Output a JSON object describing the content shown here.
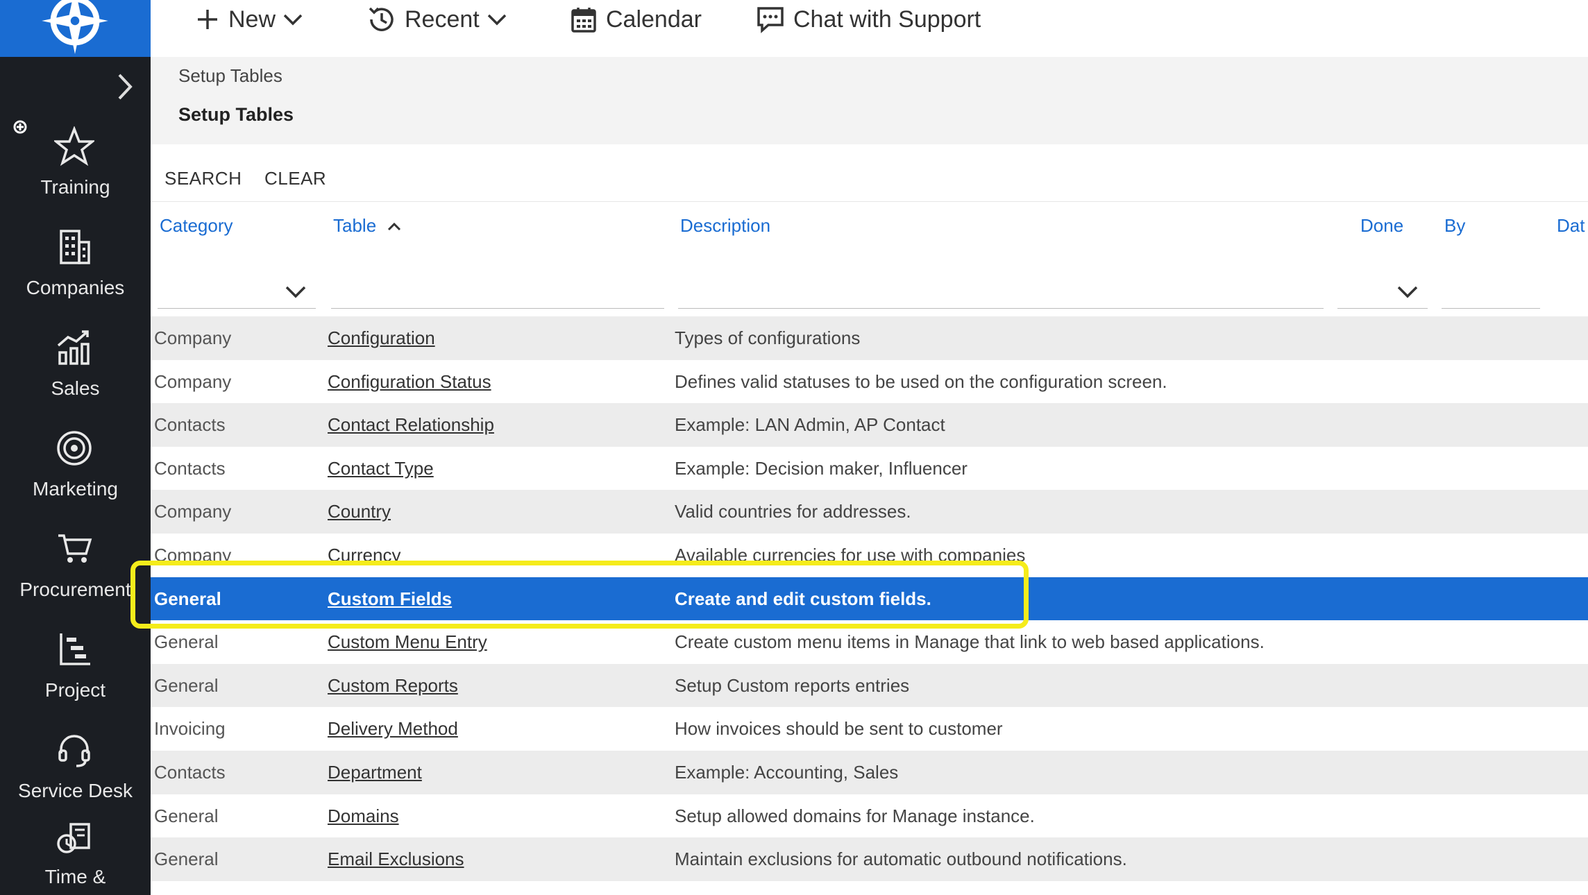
{
  "colors": {
    "sidebar": "#1b1e23",
    "accent": "#1a6cd2",
    "highlight": "#f5ec1b"
  },
  "topbar": {
    "new_label": "New",
    "recent_label": "Recent",
    "calendar_label": "Calendar",
    "chat_label": "Chat with Support"
  },
  "sidebar": {
    "items": [
      {
        "label": "Training",
        "icon": "star-icon"
      },
      {
        "label": "Companies",
        "icon": "building-icon"
      },
      {
        "label": "Sales",
        "icon": "sales-chart-icon"
      },
      {
        "label": "Marketing",
        "icon": "target-icon"
      },
      {
        "label": "Procurement",
        "icon": "cart-icon"
      },
      {
        "label": "Project",
        "icon": "project-list-icon"
      },
      {
        "label": "Service Desk",
        "icon": "headset-icon"
      },
      {
        "label": "Time &",
        "icon": "time-expense-icon"
      }
    ]
  },
  "breadcrumb": {
    "parent": "Setup Tables",
    "current": "Setup Tables"
  },
  "actions": {
    "search": "SEARCH",
    "clear": "CLEAR"
  },
  "columns": {
    "category": "Category",
    "table": "Table",
    "description": "Description",
    "done": "Done",
    "by": "By",
    "date": "Dat"
  },
  "rows": [
    {
      "category": "Company",
      "table": "Configuration",
      "description": "Types of configurations"
    },
    {
      "category": "Company",
      "table": "Configuration Status",
      "description": "Defines valid statuses to be used on the configuration screen."
    },
    {
      "category": "Contacts",
      "table": "Contact Relationship",
      "description": "Example: LAN Admin, AP Contact"
    },
    {
      "category": "Contacts",
      "table": "Contact Type",
      "description": "Example: Decision maker, Influencer"
    },
    {
      "category": "Company",
      "table": "Country",
      "description": "Valid countries for addresses."
    },
    {
      "category": "Company",
      "table": "Currency",
      "description": "Available currencies for use with companies"
    },
    {
      "category": "General",
      "table": "Custom Fields",
      "description": "Create and edit custom fields.",
      "selected": true
    },
    {
      "category": "General",
      "table": "Custom Menu Entry",
      "description": "Create custom menu items in Manage that link to web based applications."
    },
    {
      "category": "General",
      "table": "Custom Reports",
      "description": "Setup Custom reports entries"
    },
    {
      "category": "Invoicing",
      "table": "Delivery Method",
      "description": "How invoices should be sent to customer"
    },
    {
      "category": "Contacts",
      "table": "Department",
      "description": "Example: Accounting, Sales"
    },
    {
      "category": "General",
      "table": "Domains",
      "description": "Setup allowed domains for Manage instance."
    },
    {
      "category": "General",
      "table": "Email Exclusions",
      "description": "Maintain exclusions for automatic outbound notifications."
    }
  ]
}
